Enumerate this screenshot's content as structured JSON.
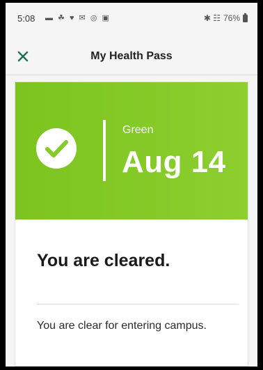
{
  "status_bar": {
    "time": "5:08",
    "left_icons": "▬ ☘ ♥ ✉ ◎ ▣",
    "right_icons": "✱ ☷",
    "battery_percent": "76%"
  },
  "app_bar": {
    "title": "My Health Pass",
    "close_icon": "close-icon"
  },
  "pass": {
    "status_label": "Green",
    "date": "Aug 14",
    "heading": "You are cleared.",
    "message": "You are clear for entering campus."
  },
  "colors": {
    "banner_start": "#7dc41f",
    "banner_end": "#8ccf2f",
    "accent": "#1f6f5f"
  }
}
